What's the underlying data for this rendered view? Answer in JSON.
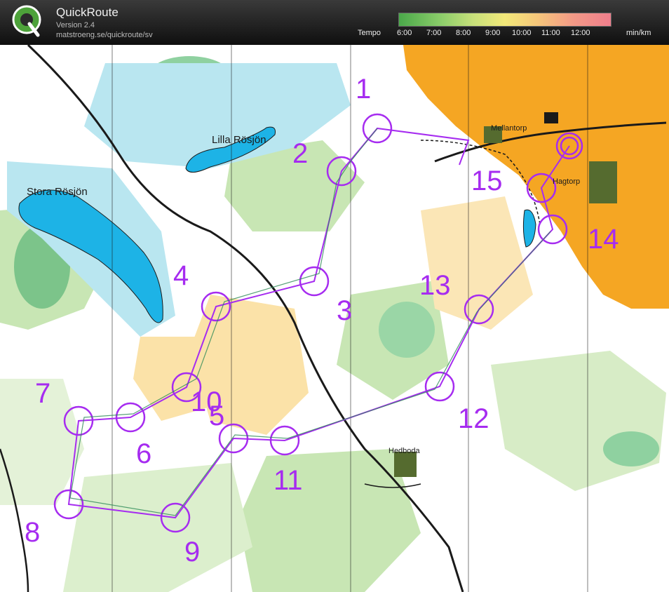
{
  "app": {
    "title": "QuickRoute",
    "version": "Version 2.4",
    "url": "matstroeng.se/quickroute/sv",
    "logo_letter": "Q"
  },
  "tempo": {
    "label": "Tempo",
    "ticks": [
      "6:00",
      "7:00",
      "8:00",
      "9:00",
      "10:00",
      "11:00",
      "12:00"
    ],
    "unit": "min/km"
  },
  "map": {
    "lakes": [
      "Lilla Rösjön",
      "Stora Rösjön"
    ],
    "places": [
      "Mellantorp",
      "Hagtorp",
      "Hedboda"
    ],
    "controls": [
      "1",
      "2",
      "3",
      "4",
      "5",
      "6",
      "7",
      "8",
      "9",
      "10",
      "11",
      "12",
      "13",
      "14",
      "15"
    ],
    "colors": {
      "course": "#a62cf0",
      "open": "#f5a623",
      "water": "#7fd4e8",
      "forest_green": "#c8e6b4"
    }
  }
}
